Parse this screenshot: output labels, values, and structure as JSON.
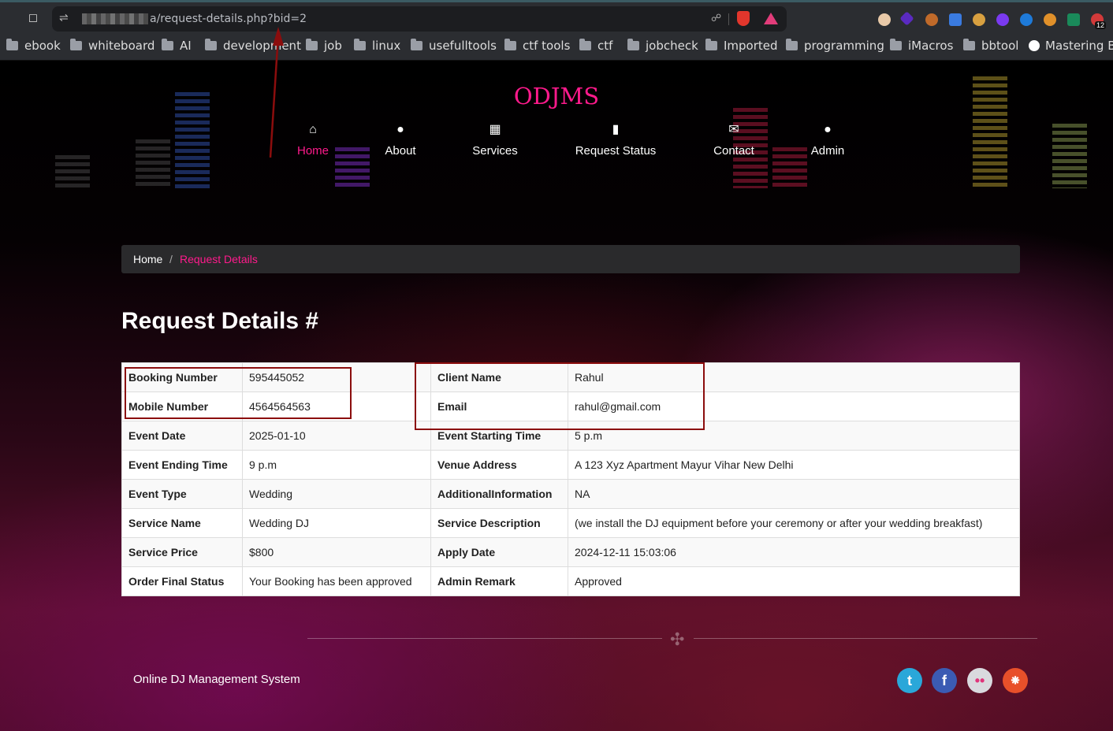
{
  "browser": {
    "url": "a/request-details.php?bid=2",
    "extension_badge": "12",
    "bookmarks": [
      "ebook",
      "whiteboard",
      "AI",
      "development",
      "job",
      "linux",
      "usefulltools",
      "ctf tools",
      "ctf",
      "jobcheck",
      "Imported",
      "programming",
      "iMacros",
      "bbtool",
      "Mastering Ba"
    ]
  },
  "site": {
    "logo": "ODJMS",
    "nav": [
      {
        "label": "Home",
        "icon": "home-icon"
      },
      {
        "label": "About",
        "icon": "user-icon"
      },
      {
        "label": "Services",
        "icon": "calendar-icon"
      },
      {
        "label": "Request Status",
        "icon": "file-icon"
      },
      {
        "label": "Contact",
        "icon": "envelope-icon"
      },
      {
        "label": "Admin",
        "icon": "user-icon"
      }
    ],
    "breadcrumb": {
      "home": "Home",
      "separator": "/",
      "current": "Request Details"
    },
    "title": "Request Details #",
    "details": [
      [
        "Booking Number",
        "595445052",
        "Client Name",
        "Rahul"
      ],
      [
        "Mobile Number",
        "4564564563",
        "Email",
        "rahul@gmail.com"
      ],
      [
        "Event Date",
        "2025-01-10",
        "Event Starting Time",
        "5 p.m"
      ],
      [
        "Event Ending Time",
        "9 p.m",
        "Venue Address",
        "A 123 Xyz Apartment Mayur Vihar New Delhi"
      ],
      [
        "Event Type",
        "Wedding",
        "AdditionalInformation",
        "NA"
      ],
      [
        "Service Name",
        "Wedding DJ",
        "Service Description",
        "(we install the DJ equipment before your ceremony or after your wedding breakfast)"
      ],
      [
        "Service Price",
        "$800",
        "Apply Date",
        "2024-12-11 15:03:06"
      ],
      [
        "Order Final Status",
        "Your Booking has been approved",
        "Admin Remark",
        "Approved"
      ]
    ],
    "footer": "Online DJ Management System",
    "social": [
      "twitter-icon",
      "facebook-icon",
      "flickr-icon",
      "rss-icon"
    ]
  },
  "colors": {
    "accent": "#ff1a8c",
    "annotation": "#8b0d0d"
  }
}
